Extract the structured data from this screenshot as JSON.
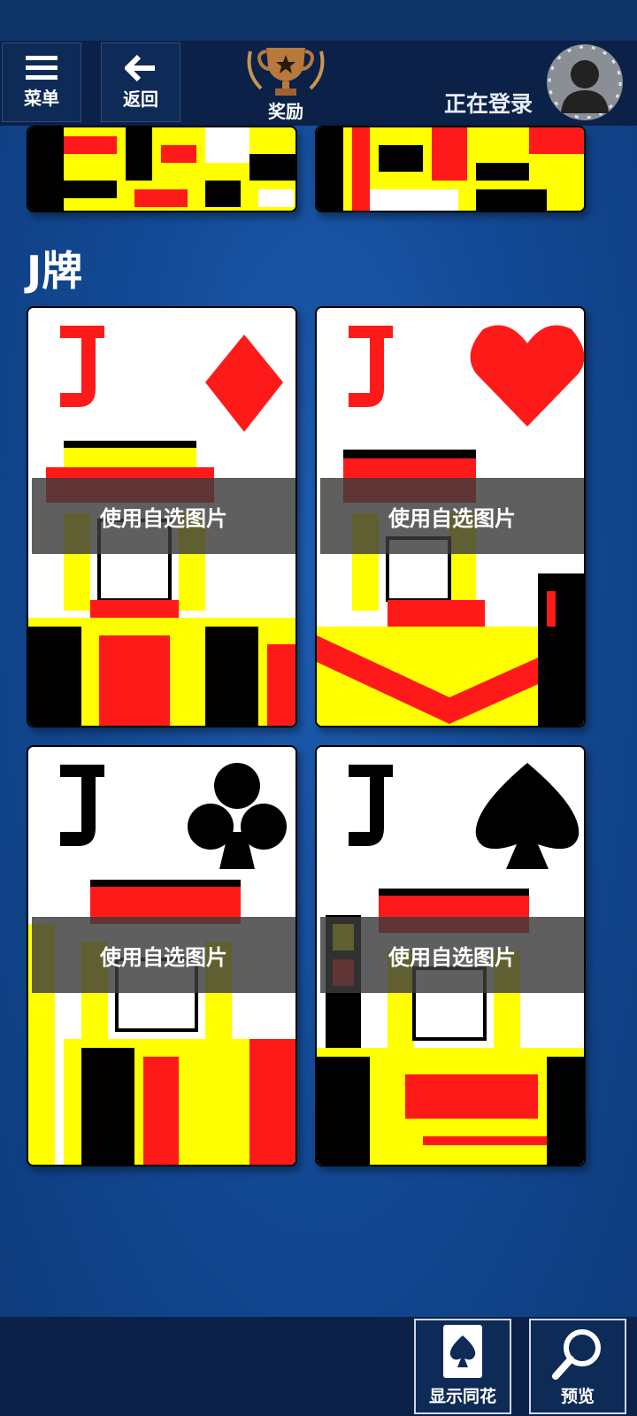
{
  "topbar": {
    "menu_label": "菜单",
    "back_label": "返回",
    "rewards_label": "奖励",
    "login_status": "正在登录"
  },
  "section": {
    "title": "J牌"
  },
  "cards": [
    {
      "rank": "J",
      "suit": "diamond",
      "overlay": "使用自选图片"
    },
    {
      "rank": "J",
      "suit": "heart",
      "overlay": "使用自选图片"
    },
    {
      "rank": "J",
      "suit": "club",
      "overlay": "使用自选图片"
    },
    {
      "rank": "J",
      "suit": "spade",
      "overlay": "使用自选图片"
    }
  ],
  "bottom": {
    "show_suit_label": "显示同花",
    "preview_label": "预览"
  },
  "colors": {
    "red": "#ff1a1a",
    "yellow": "#ffff00",
    "black": "#000000",
    "bg": "#134a96"
  }
}
